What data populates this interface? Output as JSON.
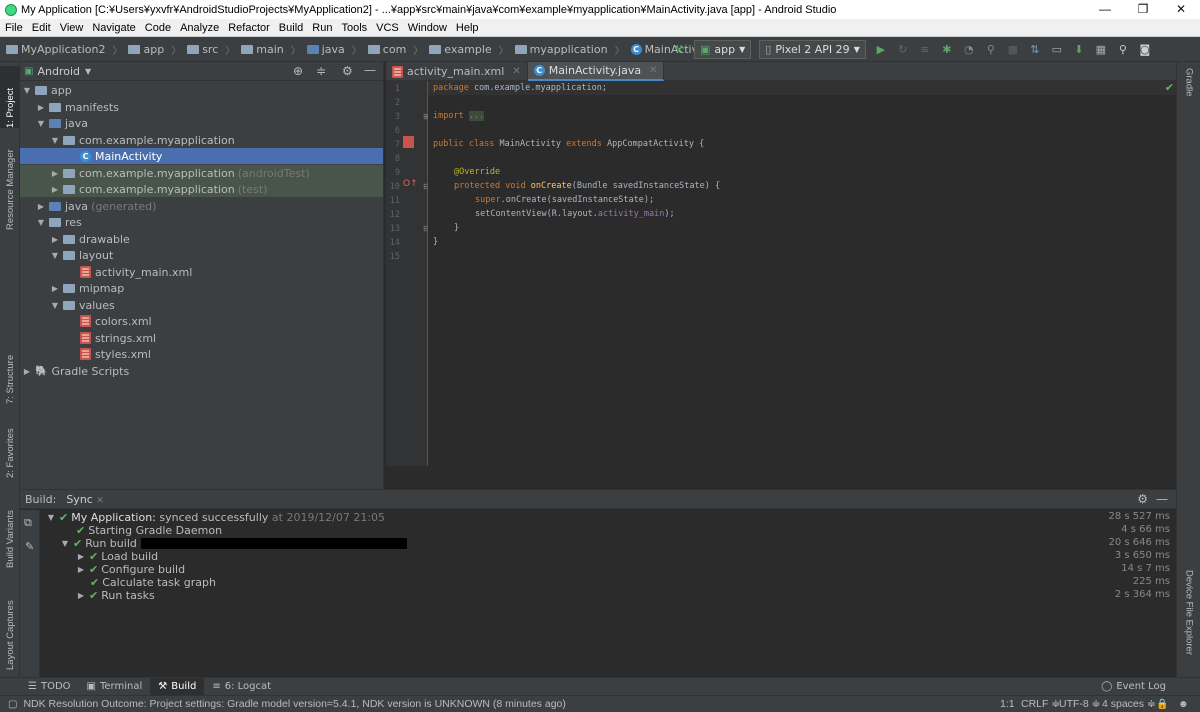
{
  "window": {
    "title": "My Application [C:¥Users¥yxvfr¥AndroidStudioProjects¥MyApplication2] - ...¥app¥src¥main¥java¥com¥example¥myapplication¥MainActivity.java [app] - Android Studio",
    "minimize": "—",
    "maximize": "❐",
    "close": "✕"
  },
  "menu": [
    "File",
    "Edit",
    "View",
    "Navigate",
    "Code",
    "Analyze",
    "Refactor",
    "Build",
    "Run",
    "Tools",
    "VCS",
    "Window",
    "Help"
  ],
  "breadcrumbs": [
    "MyApplication2",
    "app",
    "src",
    "main",
    "java",
    "com",
    "example",
    "myapplication",
    "MainActivity"
  ],
  "toolbar": {
    "config": "app",
    "device": "Pixel 2 API 29"
  },
  "left_tabs": [
    "1: Project",
    "Resource Manager",
    "7: Structure",
    "2: Favorites",
    "Build Variants",
    "Layout Captures"
  ],
  "right_tabs": [
    "Gradle",
    "Device File Explorer"
  ],
  "project": {
    "view": "Android",
    "tree": [
      {
        "label": "app",
        "extra": ""
      },
      {
        "label": "manifests",
        "extra": ""
      },
      {
        "label": "java",
        "extra": ""
      },
      {
        "label": "com.example.myapplication",
        "extra": ""
      },
      {
        "label": "MainActivity",
        "extra": ""
      },
      {
        "label": "com.example.myapplication",
        "extra": "(androidTest)"
      },
      {
        "label": "com.example.myapplication",
        "extra": "(test)"
      },
      {
        "label": "java",
        "extra": "(generated)"
      },
      {
        "label": "res",
        "extra": ""
      },
      {
        "label": "drawable",
        "extra": ""
      },
      {
        "label": "layout",
        "extra": ""
      },
      {
        "label": "activity_main.xml",
        "extra": ""
      },
      {
        "label": "mipmap",
        "extra": ""
      },
      {
        "label": "values",
        "extra": ""
      },
      {
        "label": "colors.xml",
        "extra": ""
      },
      {
        "label": "strings.xml",
        "extra": ""
      },
      {
        "label": "styles.xml",
        "extra": ""
      },
      {
        "label": "Gradle Scripts",
        "extra": ""
      }
    ]
  },
  "editor": {
    "tabs": [
      "activity_main.xml",
      "MainActivity.java"
    ],
    "line_numbers": [
      "1",
      "2",
      "3",
      "6",
      "7",
      "8",
      "9",
      "10",
      "11",
      "12",
      "13",
      "14",
      "15"
    ],
    "code": {
      "l1_kw": "package",
      "l1_rest": " com.example.myapplication;",
      "l3_kw": "import",
      "l3_fold": "...",
      "l7_kw": "public class",
      "l7_name": " MainActivity ",
      "l7_kw2": "extends",
      "l7_rest": " AppCompatActivity {",
      "l9_ann": "@Override",
      "l10_kw": "protected void",
      "l10_fn": " onCreate",
      "l10_rest": "(Bundle savedInstanceState) {",
      "l11_kw": "super",
      "l11_rest": ".onCreate(savedInstanceState);",
      "l12_a": "setContentView(R.layout.",
      "l12_fld": "activity_main",
      "l12_b": ");",
      "l13": "}",
      "l14": "}"
    }
  },
  "build": {
    "label": "Build:",
    "tab": "Sync",
    "root_label": "My Application:",
    "root_status": "synced successfully",
    "root_time": "at 2019/12/07 21:05",
    "rows": [
      "Starting Gradle Daemon",
      "Run build",
      "Load build",
      "Configure build",
      "Calculate task graph",
      "Run tasks"
    ],
    "times": [
      "28 s 527 ms",
      "4 s 66 ms",
      "20 s 646 ms",
      "3 s 650 ms",
      "14 s 7 ms",
      "225 ms",
      "2 s 364 ms"
    ]
  },
  "bottom_tabs": [
    "TODO",
    "Terminal",
    "Build",
    "6: Logcat"
  ],
  "event_log": "Event Log",
  "status": {
    "message": "NDK Resolution Outcome: Project settings: Gradle model version=5.4.1, NDK version is UNKNOWN (8 minutes ago)",
    "position": "1:1",
    "line_sep": "CRLF ≑",
    "encoding": "UTF-8 ≑",
    "indent": "4 spaces ≑"
  }
}
